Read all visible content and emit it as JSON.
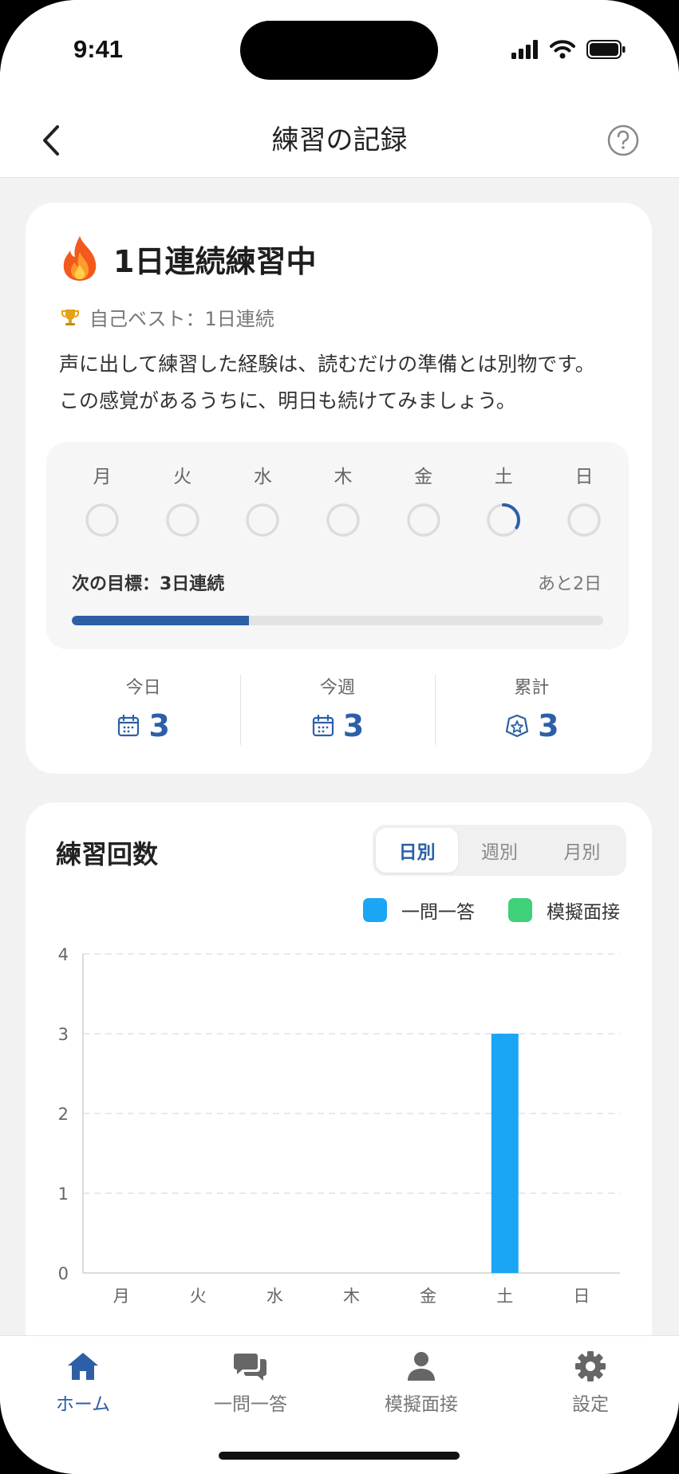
{
  "status_bar": {
    "time": "9:41"
  },
  "header": {
    "title": "練習の記録"
  },
  "streak": {
    "title": "1日連続練習中",
    "best": "自己ベスト：1日連続",
    "message_line1": "声に出して練習した経験は、読むだけの準備とは別物です。",
    "message_line2": "この感覚があるうちに、明日も続けてみましょう。",
    "week": [
      {
        "label": "月",
        "progress": 0
      },
      {
        "label": "火",
        "progress": 0
      },
      {
        "label": "水",
        "progress": 0
      },
      {
        "label": "木",
        "progress": 0
      },
      {
        "label": "金",
        "progress": 0
      },
      {
        "label": "土",
        "progress": 0.333
      },
      {
        "label": "日",
        "progress": 0
      }
    ],
    "next_goal": "次の目標：3日連続",
    "remaining": "あと2日",
    "goal_progress": 0.333
  },
  "stats": [
    {
      "label": "今日",
      "value": "3",
      "icon": "calendar-icon"
    },
    {
      "label": "今週",
      "value": "3",
      "icon": "calendar-icon"
    },
    {
      "label": "累計",
      "value": "3",
      "icon": "star-badge-icon"
    }
  ],
  "practice": {
    "title": "練習回数",
    "tabs": [
      "日別",
      "週別",
      "月別"
    ],
    "active_tab": "日別",
    "legend": [
      {
        "name": "一問一答",
        "color": "#1aa6f5"
      },
      {
        "name": "模擬面接",
        "color": "#3fd07a"
      }
    ]
  },
  "chart_data": {
    "type": "bar",
    "categories": [
      "月",
      "火",
      "水",
      "木",
      "金",
      "土",
      "日"
    ],
    "series": [
      {
        "name": "一問一答",
        "values": [
          0,
          0,
          0,
          0,
          0,
          3,
          0
        ]
      },
      {
        "name": "模擬面接",
        "values": [
          0,
          0,
          0,
          0,
          0,
          0,
          0
        ]
      }
    ],
    "ylim": [
      0,
      4
    ],
    "yticks": [
      0,
      1,
      2,
      3,
      4
    ],
    "grid": true,
    "legend": "top-right",
    "stacked": true
  },
  "tabbar": [
    {
      "label": "ホーム",
      "icon": "home-icon",
      "active": true
    },
    {
      "label": "一問一答",
      "icon": "chat-icon",
      "active": false
    },
    {
      "label": "模擬面接",
      "icon": "person-icon",
      "active": false
    },
    {
      "label": "設定",
      "icon": "gear-icon",
      "active": false
    }
  ],
  "colors": {
    "accent": "#2c5fa6",
    "bar_primary": "#1aa6f5",
    "bar_secondary": "#3fd07a"
  }
}
